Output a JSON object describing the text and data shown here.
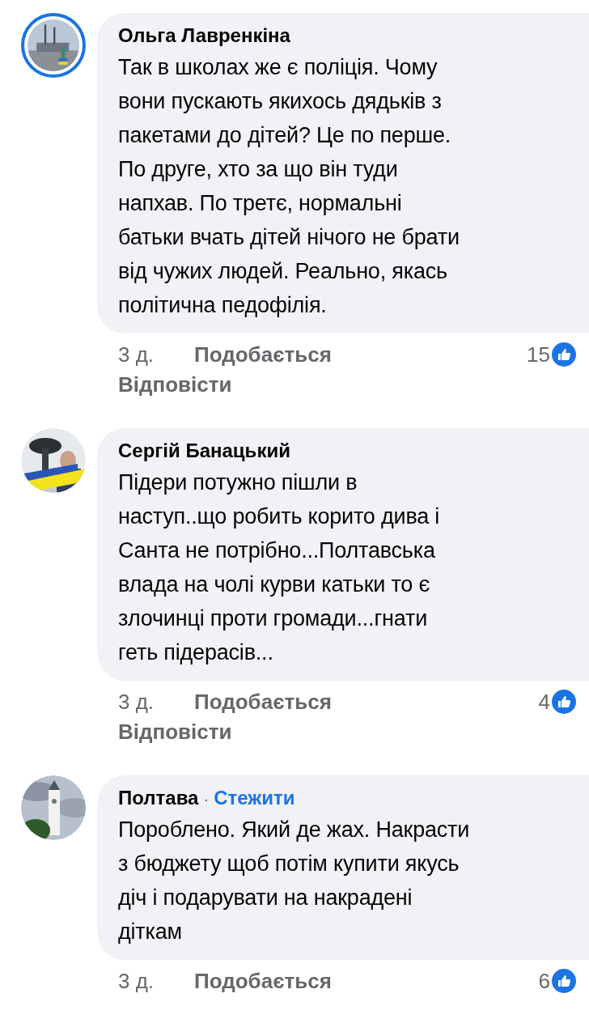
{
  "comments": [
    {
      "author": "Ольга Лавренкіна",
      "story_ring": true,
      "text": "Так в школах же є поліція. Чому\nвони пускають якихось дядьків з\nпакетами до дітей? Це по перше.\nПо друге, хто за що він туди\nнапхав. По третє, нормальні\nбатьки вчать дітей нічого не брати\nвід чужих людей. Реально, якась\nполітична педофілія.",
      "time": "3 д.",
      "like_label": "Подобається",
      "likes": "15",
      "reply_label": "Відповісти"
    },
    {
      "author": "Сергій Банацький",
      "story_ring": false,
      "text": "Підери потужно пішли в\nнаступ..що робить корито  дива і\nСанта  не потрібно...Полтавська\nвлада на чолі курви катьки то є\nзлочинці проти громади...гнати\nгеть підерасів...",
      "time": "3 д.",
      "like_label": "Подобається",
      "likes": "4",
      "reply_label": "Відповісти"
    },
    {
      "author": "Полтава",
      "separator": "·",
      "follow": "Стежити",
      "story_ring": false,
      "text": "Пороблено. Який де жах. Накрасти\nз бюджету щоб потім купити якусь\nдіч і подарувати на накрадені\nдіткам",
      "time": "3 д.",
      "like_label": "Подобається",
      "likes": "6"
    }
  ]
}
